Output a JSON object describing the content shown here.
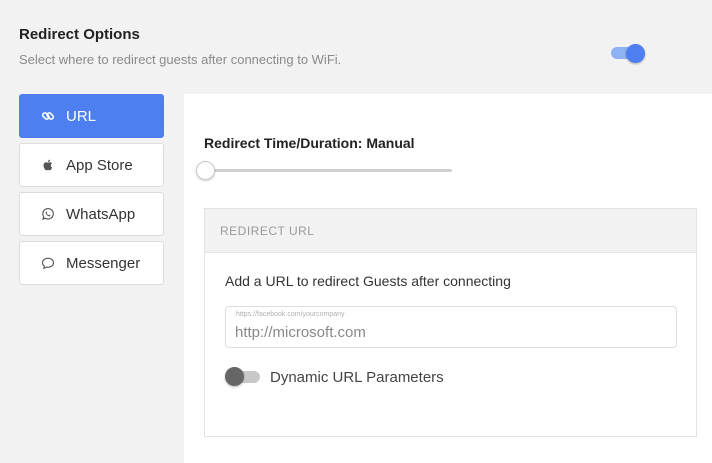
{
  "header": {
    "title": "Redirect Options",
    "subtitle": "Select where to redirect guests after connecting to WiFi."
  },
  "redirect_toggle": {
    "enabled": true,
    "accent": "#4d7ff0"
  },
  "tabs": [
    {
      "label": "URL",
      "icon": "link-icon",
      "active": true
    },
    {
      "label": "App Store",
      "icon": "apple-icon",
      "active": false
    },
    {
      "label": "WhatsApp",
      "icon": "whatsapp-icon",
      "active": false
    },
    {
      "label": "Messenger",
      "icon": "messenger-icon",
      "active": false
    }
  ],
  "duration": {
    "label": "Redirect Time/Duration: Manual",
    "slider_value": 0
  },
  "redirect_url": {
    "section_title": "REDIRECT URL",
    "instruction": "Add a URL to redirect Guests after connecting",
    "placeholder": "https://facebook.com/yourcompany",
    "value": "http://microsoft.com",
    "dynamic_params_label": "Dynamic URL Parameters",
    "dynamic_params_enabled": false
  }
}
